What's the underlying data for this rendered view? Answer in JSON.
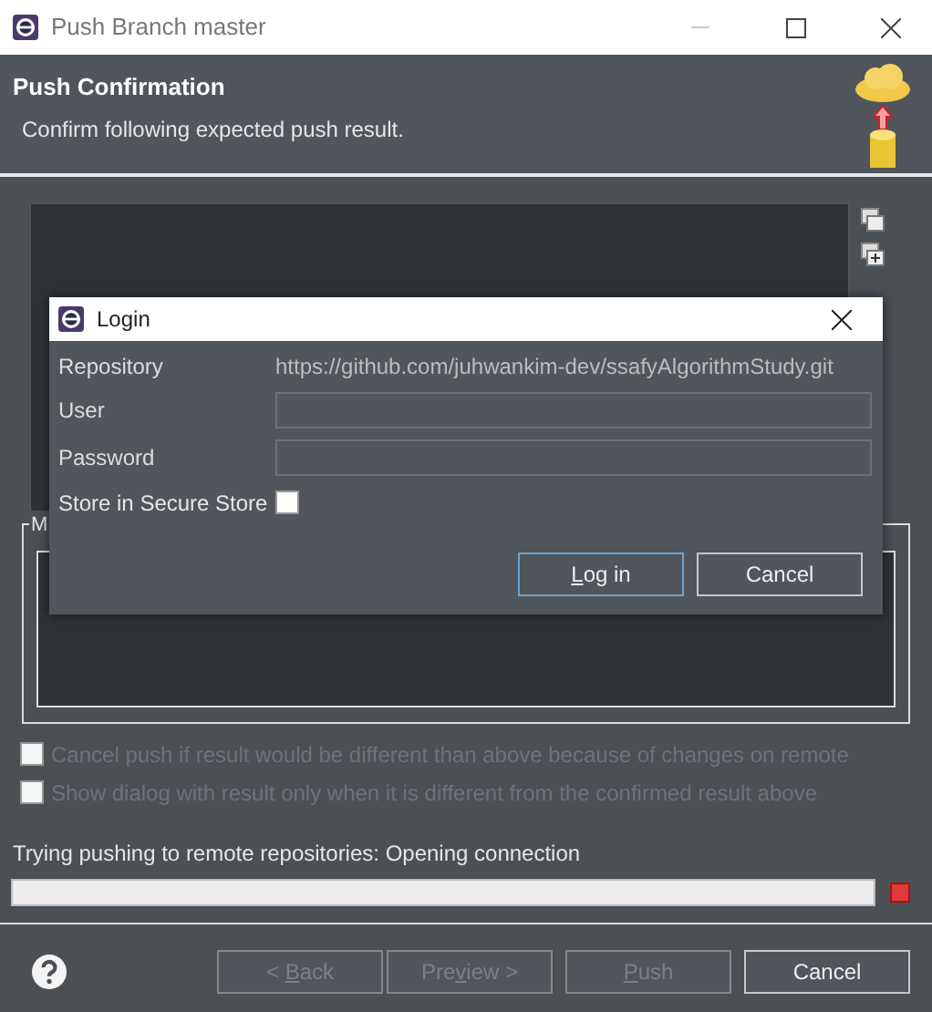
{
  "window": {
    "title": "Push Branch master"
  },
  "header": {
    "title": "Push Confirmation",
    "description": "Confirm following expected push result."
  },
  "results_group": {
    "label": "M"
  },
  "options": [
    {
      "label": "Cancel push if result would be different than above because of changes on remote",
      "checked": false,
      "disabled": true
    },
    {
      "label": "Show dialog with result only when it is different from the confirmed result above",
      "checked": false,
      "disabled": true
    }
  ],
  "status": {
    "message": "Trying pushing to remote repositories: Opening connection",
    "level": 0
  },
  "buttons": [
    {
      "prefix": "< ",
      "key": "B",
      "rest": "ack",
      "disabled": true
    },
    {
      "prefix": "Pre",
      "key": "v",
      "rest": "iew >",
      "disabled": true
    },
    {
      "key": "P",
      "rest": "ush",
      "disabled": true
    },
    {
      "prefix": "Cancel",
      "disabled": false
    }
  ],
  "login": {
    "title": "Login",
    "fields": [
      {
        "kind": "text",
        "label": "Repository",
        "value": "https://github.com/juhwankim-dev/ssafyAlgorithmStudy.git"
      },
      {
        "kind": "input",
        "label": "User"
      },
      {
        "kind": "input",
        "label": "Password"
      },
      {
        "kind": "checkbox",
        "label": "Store in Secure Store",
        "checked": false
      }
    ],
    "buttons": [
      {
        "key": "L",
        "rest": "og in",
        "focused": true
      },
      {
        "prefix": "Cancel",
        "focused": false
      }
    ]
  }
}
